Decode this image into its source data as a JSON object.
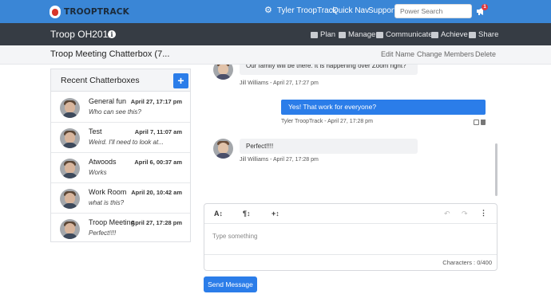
{
  "topnav": {
    "brand": "TROOPTRACK",
    "user": "Tyler TroopTrack",
    "quick_nav": "Quick Nav",
    "support": "Support",
    "search_placeholder": "Power Search",
    "notifications_count": "1",
    "brand_color": "#3a86d6"
  },
  "troopbar": {
    "title": "Troop OH2012",
    "menu": [
      "Plan",
      "Manage",
      "Communicate",
      "Achieve",
      "Share"
    ]
  },
  "subheader": {
    "title": "Troop Meeting Chatterbox (7...",
    "actions": [
      "Edit Name",
      "Change Members",
      "Delete"
    ]
  },
  "chatterboxes": {
    "title": "Recent Chatterboxes",
    "add_label": "+",
    "items": [
      {
        "name": "General fun",
        "date": "April 27, 17:17 pm",
        "preview": "Who can see this?"
      },
      {
        "name": "Test",
        "date": "April 7, 11:07 am",
        "preview": "Weird. I'll need to look at..."
      },
      {
        "name": "Atwoods",
        "date": "April 6, 00:37 am",
        "preview": "Works"
      },
      {
        "name": "Work Room",
        "date": "April 20, 10:42 am",
        "preview": "what is this?"
      },
      {
        "name": "Troop Meeting",
        "date": "April 27, 17:28 pm",
        "preview": "Perfect!!!!"
      }
    ]
  },
  "messages": [
    {
      "text": "Our family will be there. It is happening over Zoom right?",
      "meta": "Jill Williams - April 27, 17:27 pm",
      "own": false
    },
    {
      "text": "Yes! That work for everyone?",
      "meta": "Tyler TroopTrack - April 27, 17:28 pm",
      "own": true
    },
    {
      "text": "Perfect!!!!",
      "meta": "Jill Williams - April 27, 17:28 pm",
      "own": false
    }
  ],
  "editor": {
    "placeholder": "Type something",
    "char_count": "Characters : 0/400",
    "toolbar": [
      "A↕",
      "¶↕",
      "+↕"
    ]
  },
  "send_label": "Send Message"
}
